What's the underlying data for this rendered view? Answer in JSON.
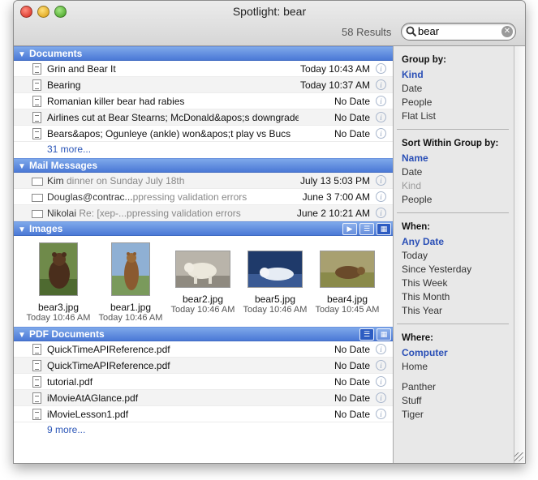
{
  "window": {
    "title": "Spotlight: bear",
    "results_count": "58 Results"
  },
  "search": {
    "value": "bear",
    "clear_icon": "clear-icon",
    "search_icon": "search-icon"
  },
  "documents": {
    "header": "Documents",
    "items": [
      {
        "title": "Grin and Bear It",
        "date": "Today 10:43 AM"
      },
      {
        "title": "Bearing",
        "date": "Today 10:37 AM"
      },
      {
        "title": "Romanian killer bear had rabies",
        "date": "No Date"
      },
      {
        "title": "Airlines cut at Bear Stearns; McDonald&apos;s downgraded",
        "date": "No Date"
      },
      {
        "title": "Bears&apos; Ogunleye (ankle) won&apos;t play vs Bucs",
        "date": "No Date"
      }
    ],
    "more": "31 more..."
  },
  "mail": {
    "header": "Mail Messages",
    "items": [
      {
        "from": "Kim",
        "snippet": " dinner on Sunday July 18th",
        "date": "July 13 5:03 PM"
      },
      {
        "from": "Douglas@contrac...",
        "snippet": "ppressing validation errors",
        "date": "June 3 7:00 AM"
      },
      {
        "from": "Nikolai",
        "snippet": " Re: [xep-...ppressing validation errors",
        "date": "June 2 10:21 AM"
      }
    ]
  },
  "images": {
    "header": "Images",
    "items": [
      {
        "name": "bear3.jpg",
        "date": "Today 10:46 AM"
      },
      {
        "name": "bear1.jpg",
        "date": "Today 10:46 AM"
      },
      {
        "name": "bear2.jpg",
        "date": "Today 10:46 AM"
      },
      {
        "name": "bear5.jpg",
        "date": "Today 10:46 AM"
      },
      {
        "name": "bear4.jpg",
        "date": "Today 10:45 AM"
      }
    ]
  },
  "pdf": {
    "header": "PDF Documents",
    "items": [
      {
        "title": "QuickTimeAPIReference.pdf",
        "date": "No Date"
      },
      {
        "title": "QuickTimeAPIReference.pdf",
        "date": "No Date"
      },
      {
        "title": "tutorial.pdf",
        "date": "No Date"
      },
      {
        "title": "iMovieAtAGlance.pdf",
        "date": "No Date"
      },
      {
        "title": "iMovieLesson1.pdf",
        "date": "No Date"
      }
    ],
    "more": "9 more..."
  },
  "sidebar": {
    "group_by": {
      "heading": "Group by:",
      "options": [
        "Kind",
        "Date",
        "People",
        "Flat List"
      ],
      "selected": "Kind"
    },
    "sort_within": {
      "heading": "Sort Within Group by:",
      "options": [
        "Name",
        "Date",
        "Kind",
        "People"
      ],
      "selected": "Name",
      "disabled": "Kind"
    },
    "when": {
      "heading": "When:",
      "options": [
        "Any Date",
        "Today",
        "Since Yesterday",
        "This Week",
        "This Month",
        "This Year"
      ],
      "selected": "Any Date"
    },
    "where": {
      "heading": "Where:",
      "options": [
        "Computer",
        "Home"
      ],
      "volumes": [
        "Panther",
        "Stuff",
        "Tiger"
      ],
      "selected": "Computer"
    }
  },
  "colors": {
    "group_header": "#5a86dc",
    "link": "#2a55b7",
    "sidebar_selected": "#2a4fb6"
  }
}
